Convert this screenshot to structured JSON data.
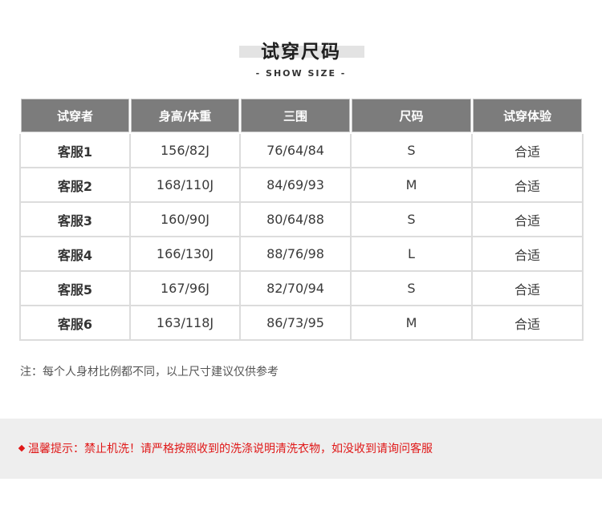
{
  "header": {
    "title": "试穿尺码",
    "subtitle": "- SHOW SIZE -"
  },
  "table": {
    "columns": [
      "试穿者",
      "身高/体重",
      "三围",
      "尺码",
      "试穿体验"
    ],
    "rows": [
      [
        "客服1",
        "156/82J",
        "76/64/84",
        "S",
        "合适"
      ],
      [
        "客服2",
        "168/110J",
        "84/69/93",
        "M",
        "合适"
      ],
      [
        "客服3",
        "160/90J",
        "80/64/88",
        "S",
        "合适"
      ],
      [
        "客服4",
        "166/130J",
        "88/76/98",
        "L",
        "合适"
      ],
      [
        "客服5",
        "167/96J",
        "82/70/94",
        "S",
        "合适"
      ],
      [
        "客服6",
        "163/118J",
        "86/73/95",
        "M",
        "合适"
      ]
    ]
  },
  "note": "注：每个人身材比例都不同，以上尺寸建议仅供参考",
  "notice": {
    "text": "温馨提示：禁止机洗！请严格按照收到的洗涤说明清洗衣物，如没收到请询问客服",
    "color": "#e01818"
  },
  "colors": {
    "header_bg": "#7c7c7c",
    "grid": "#dcdcdc",
    "notice_bg": "#eeeeee"
  }
}
